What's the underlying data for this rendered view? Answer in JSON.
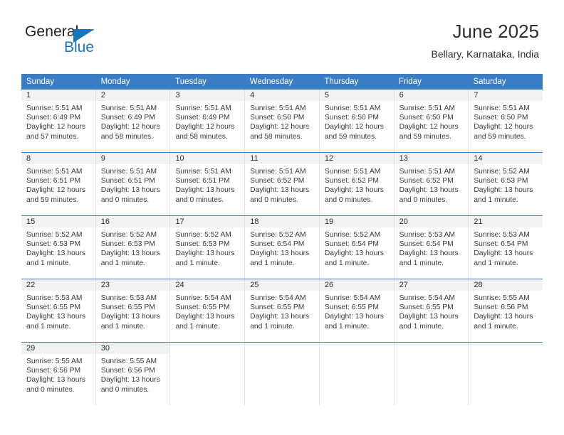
{
  "brand": {
    "name_part1": "General",
    "name_part2": "Blue",
    "accent_color": "#1b75bb",
    "triangle_icon": "triangle-icon"
  },
  "header": {
    "title": "June 2025",
    "subtitle": "Bellary, Karnataka, India"
  },
  "calendar": {
    "header_bg": "#3b7dc4",
    "weekdays": [
      "Sunday",
      "Monday",
      "Tuesday",
      "Wednesday",
      "Thursday",
      "Friday",
      "Saturday"
    ],
    "weeks": [
      [
        {
          "day": "1",
          "sunrise": "Sunrise: 5:51 AM",
          "sunset": "Sunset: 6:49 PM",
          "daylight_line1": "Daylight: 12 hours",
          "daylight_line2": "and 57 minutes."
        },
        {
          "day": "2",
          "sunrise": "Sunrise: 5:51 AM",
          "sunset": "Sunset: 6:49 PM",
          "daylight_line1": "Daylight: 12 hours",
          "daylight_line2": "and 58 minutes."
        },
        {
          "day": "3",
          "sunrise": "Sunrise: 5:51 AM",
          "sunset": "Sunset: 6:49 PM",
          "daylight_line1": "Daylight: 12 hours",
          "daylight_line2": "and 58 minutes."
        },
        {
          "day": "4",
          "sunrise": "Sunrise: 5:51 AM",
          "sunset": "Sunset: 6:50 PM",
          "daylight_line1": "Daylight: 12 hours",
          "daylight_line2": "and 58 minutes."
        },
        {
          "day": "5",
          "sunrise": "Sunrise: 5:51 AM",
          "sunset": "Sunset: 6:50 PM",
          "daylight_line1": "Daylight: 12 hours",
          "daylight_line2": "and 59 minutes."
        },
        {
          "day": "6",
          "sunrise": "Sunrise: 5:51 AM",
          "sunset": "Sunset: 6:50 PM",
          "daylight_line1": "Daylight: 12 hours",
          "daylight_line2": "and 59 minutes."
        },
        {
          "day": "7",
          "sunrise": "Sunrise: 5:51 AM",
          "sunset": "Sunset: 6:50 PM",
          "daylight_line1": "Daylight: 12 hours",
          "daylight_line2": "and 59 minutes."
        }
      ],
      [
        {
          "day": "8",
          "sunrise": "Sunrise: 5:51 AM",
          "sunset": "Sunset: 6:51 PM",
          "daylight_line1": "Daylight: 12 hours",
          "daylight_line2": "and 59 minutes."
        },
        {
          "day": "9",
          "sunrise": "Sunrise: 5:51 AM",
          "sunset": "Sunset: 6:51 PM",
          "daylight_line1": "Daylight: 13 hours",
          "daylight_line2": "and 0 minutes."
        },
        {
          "day": "10",
          "sunrise": "Sunrise: 5:51 AM",
          "sunset": "Sunset: 6:51 PM",
          "daylight_line1": "Daylight: 13 hours",
          "daylight_line2": "and 0 minutes."
        },
        {
          "day": "11",
          "sunrise": "Sunrise: 5:51 AM",
          "sunset": "Sunset: 6:52 PM",
          "daylight_line1": "Daylight: 13 hours",
          "daylight_line2": "and 0 minutes."
        },
        {
          "day": "12",
          "sunrise": "Sunrise: 5:51 AM",
          "sunset": "Sunset: 6:52 PM",
          "daylight_line1": "Daylight: 13 hours",
          "daylight_line2": "and 0 minutes."
        },
        {
          "day": "13",
          "sunrise": "Sunrise: 5:51 AM",
          "sunset": "Sunset: 6:52 PM",
          "daylight_line1": "Daylight: 13 hours",
          "daylight_line2": "and 0 minutes."
        },
        {
          "day": "14",
          "sunrise": "Sunrise: 5:52 AM",
          "sunset": "Sunset: 6:53 PM",
          "daylight_line1": "Daylight: 13 hours",
          "daylight_line2": "and 1 minute."
        }
      ],
      [
        {
          "day": "15",
          "sunrise": "Sunrise: 5:52 AM",
          "sunset": "Sunset: 6:53 PM",
          "daylight_line1": "Daylight: 13 hours",
          "daylight_line2": "and 1 minute."
        },
        {
          "day": "16",
          "sunrise": "Sunrise: 5:52 AM",
          "sunset": "Sunset: 6:53 PM",
          "daylight_line1": "Daylight: 13 hours",
          "daylight_line2": "and 1 minute."
        },
        {
          "day": "17",
          "sunrise": "Sunrise: 5:52 AM",
          "sunset": "Sunset: 6:53 PM",
          "daylight_line1": "Daylight: 13 hours",
          "daylight_line2": "and 1 minute."
        },
        {
          "day": "18",
          "sunrise": "Sunrise: 5:52 AM",
          "sunset": "Sunset: 6:54 PM",
          "daylight_line1": "Daylight: 13 hours",
          "daylight_line2": "and 1 minute."
        },
        {
          "day": "19",
          "sunrise": "Sunrise: 5:52 AM",
          "sunset": "Sunset: 6:54 PM",
          "daylight_line1": "Daylight: 13 hours",
          "daylight_line2": "and 1 minute."
        },
        {
          "day": "20",
          "sunrise": "Sunrise: 5:53 AM",
          "sunset": "Sunset: 6:54 PM",
          "daylight_line1": "Daylight: 13 hours",
          "daylight_line2": "and 1 minute."
        },
        {
          "day": "21",
          "sunrise": "Sunrise: 5:53 AM",
          "sunset": "Sunset: 6:54 PM",
          "daylight_line1": "Daylight: 13 hours",
          "daylight_line2": "and 1 minute."
        }
      ],
      [
        {
          "day": "22",
          "sunrise": "Sunrise: 5:53 AM",
          "sunset": "Sunset: 6:55 PM",
          "daylight_line1": "Daylight: 13 hours",
          "daylight_line2": "and 1 minute."
        },
        {
          "day": "23",
          "sunrise": "Sunrise: 5:53 AM",
          "sunset": "Sunset: 6:55 PM",
          "daylight_line1": "Daylight: 13 hours",
          "daylight_line2": "and 1 minute."
        },
        {
          "day": "24",
          "sunrise": "Sunrise: 5:54 AM",
          "sunset": "Sunset: 6:55 PM",
          "daylight_line1": "Daylight: 13 hours",
          "daylight_line2": "and 1 minute."
        },
        {
          "day": "25",
          "sunrise": "Sunrise: 5:54 AM",
          "sunset": "Sunset: 6:55 PM",
          "daylight_line1": "Daylight: 13 hours",
          "daylight_line2": "and 1 minute."
        },
        {
          "day": "26",
          "sunrise": "Sunrise: 5:54 AM",
          "sunset": "Sunset: 6:55 PM",
          "daylight_line1": "Daylight: 13 hours",
          "daylight_line2": "and 1 minute."
        },
        {
          "day": "27",
          "sunrise": "Sunrise: 5:54 AM",
          "sunset": "Sunset: 6:55 PM",
          "daylight_line1": "Daylight: 13 hours",
          "daylight_line2": "and 1 minute."
        },
        {
          "day": "28",
          "sunrise": "Sunrise: 5:55 AM",
          "sunset": "Sunset: 6:56 PM",
          "daylight_line1": "Daylight: 13 hours",
          "daylight_line2": "and 1 minute."
        }
      ],
      [
        {
          "day": "29",
          "sunrise": "Sunrise: 5:55 AM",
          "sunset": "Sunset: 6:56 PM",
          "daylight_line1": "Daylight: 13 hours",
          "daylight_line2": "and 0 minutes."
        },
        {
          "day": "30",
          "sunrise": "Sunrise: 5:55 AM",
          "sunset": "Sunset: 6:56 PM",
          "daylight_line1": "Daylight: 13 hours",
          "daylight_line2": "and 0 minutes."
        },
        {
          "day": "",
          "sunrise": "",
          "sunset": "",
          "daylight_line1": "",
          "daylight_line2": ""
        },
        {
          "day": "",
          "sunrise": "",
          "sunset": "",
          "daylight_line1": "",
          "daylight_line2": ""
        },
        {
          "day": "",
          "sunrise": "",
          "sunset": "",
          "daylight_line1": "",
          "daylight_line2": ""
        },
        {
          "day": "",
          "sunrise": "",
          "sunset": "",
          "daylight_line1": "",
          "daylight_line2": ""
        },
        {
          "day": "",
          "sunrise": "",
          "sunset": "",
          "daylight_line1": "",
          "daylight_line2": ""
        }
      ]
    ]
  }
}
